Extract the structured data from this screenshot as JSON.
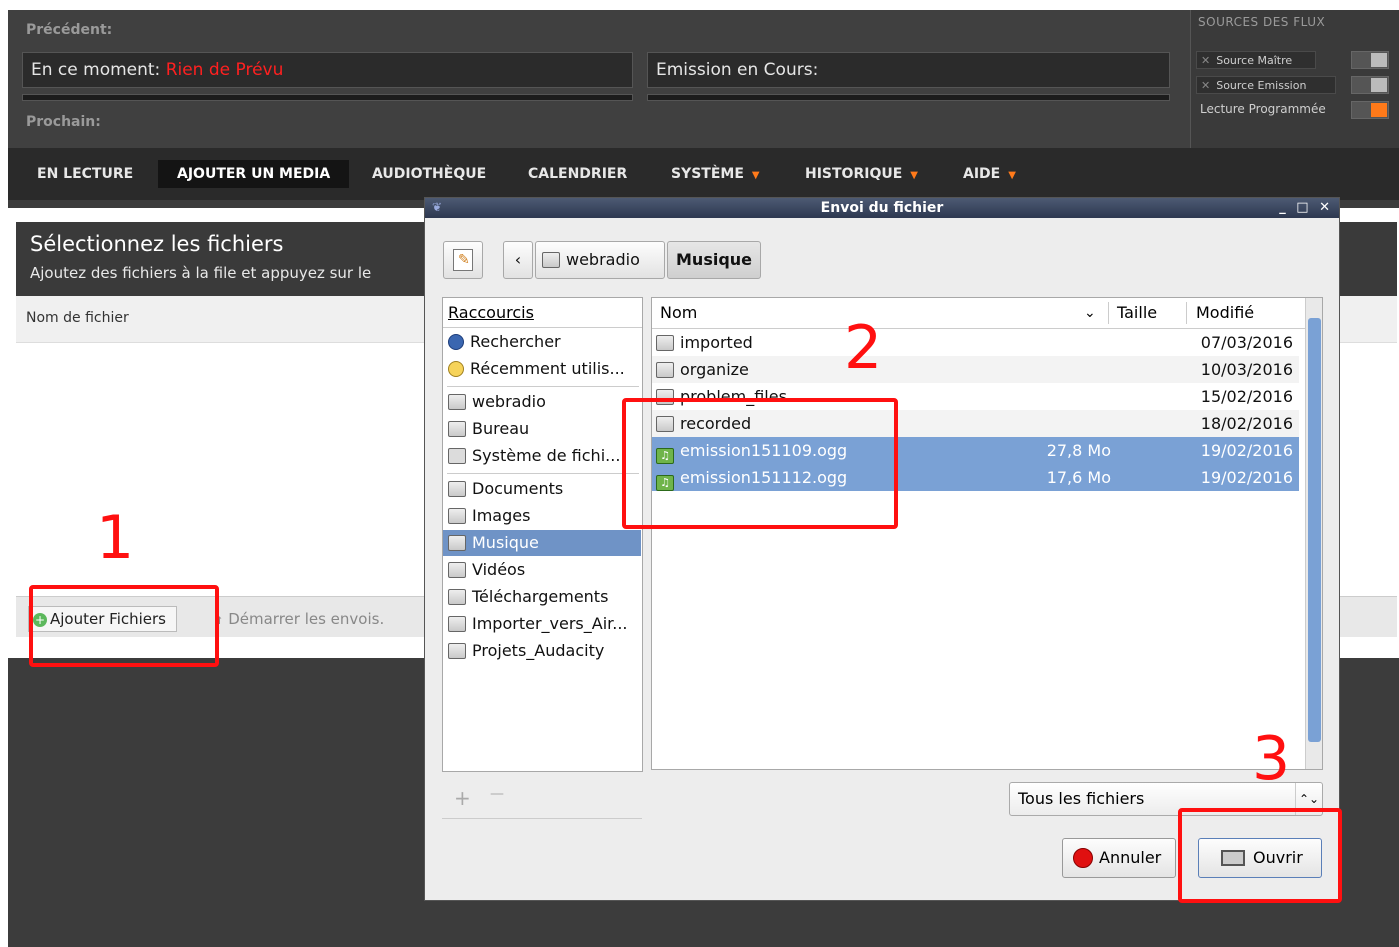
{
  "header": {
    "previous_label": "Précédent:",
    "current_prefix": "En ce moment:",
    "current_value": "Rien de Prévu",
    "show_label": "Emission en Cours:",
    "next_label": "Prochain:"
  },
  "sources": {
    "title": "SOURCES DES FLUX",
    "master": "Source Maître",
    "show": "Source Emission",
    "scheduled": "Lecture Programmée",
    "close_glyph": "✕"
  },
  "nav": {
    "items": [
      "EN LECTURE",
      "AJOUTER UN MEDIA",
      "AUDIOTHÈQUE",
      "CALENDRIER",
      "SYSTÈME",
      "HISTORIQUE",
      "AIDE"
    ],
    "caret": "▼"
  },
  "upload": {
    "title": "Sélectionnez les fichiers",
    "subtitle": "Ajoutez des fichiers à la file et appuyez sur le",
    "column": "Nom de fichier",
    "add_button": "Ajouter Fichiers",
    "start_button": "Démarrer les envois."
  },
  "dialog": {
    "title": "Envoi du fichier",
    "window_controls": "_ □ ✕",
    "path": [
      "webradio",
      "Musique"
    ],
    "back": "‹",
    "shortcuts_header": "Raccourcis",
    "shortcuts": [
      "Rechercher",
      "Récemment utilis...",
      "webradio",
      "Bureau",
      "Système de fichi...",
      "Documents",
      "Images",
      "Musique",
      "Vidéos",
      "Téléchargements",
      "Importer_vers_Air...",
      "Projets_Audacity"
    ],
    "add_glyph": "+",
    "remove_glyph": "—",
    "columns": {
      "name": "Nom",
      "size": "Taille",
      "modified": "Modifié",
      "sort": "⌄"
    },
    "files": [
      {
        "name": "imported",
        "size": "",
        "modified": "07/03/2016",
        "type": "folder"
      },
      {
        "name": "organize",
        "size": "",
        "modified": "10/03/2016",
        "type": "folder"
      },
      {
        "name": "problem_files",
        "size": "",
        "modified": "15/02/2016",
        "type": "folder"
      },
      {
        "name": "recorded",
        "size": "",
        "modified": "18/02/2016",
        "type": "folder"
      },
      {
        "name": "emission151109.ogg",
        "size": "27,8 Mo",
        "modified": "19/02/2016",
        "type": "audio"
      },
      {
        "name": "emission151112.ogg",
        "size": "17,6 Mo",
        "modified": "19/02/2016",
        "type": "audio"
      }
    ],
    "filter": "Tous les fichiers",
    "filter_arrow": "⌃⌄",
    "cancel": "Annuler",
    "open": "Ouvrir"
  },
  "annotations": {
    "one": "1",
    "two": "2",
    "three": "3"
  },
  "colors": {
    "accent_orange": "#ff7a1a",
    "annotation_red": "#ff1010",
    "selection_blue": "#7aa1d5"
  }
}
